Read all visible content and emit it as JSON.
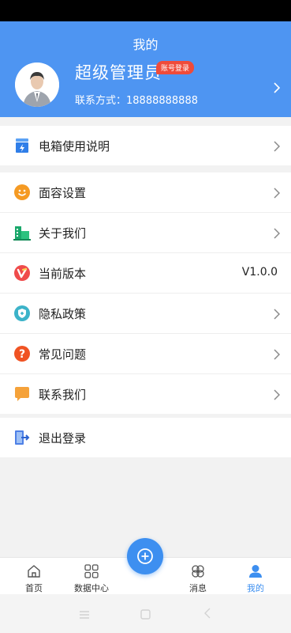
{
  "header": {
    "title": "我的",
    "username": "超级管理员",
    "badge": "账号登录",
    "contact": "联系方式：18888888888"
  },
  "menu_top": [
    {
      "label": "电箱使用说明",
      "icon": "electric-box-icon"
    }
  ],
  "menu_main": [
    {
      "label": "面容设置",
      "icon": "face-icon"
    },
    {
      "label": "关于我们",
      "icon": "building-icon"
    },
    {
      "label": "当前版本",
      "icon": "version-icon",
      "value": "V1.0.0"
    },
    {
      "label": "隐私政策",
      "icon": "shield-icon"
    },
    {
      "label": "常见问题",
      "icon": "question-icon"
    },
    {
      "label": "联系我们",
      "icon": "chat-icon"
    }
  ],
  "menu_bottom": [
    {
      "label": "退出登录",
      "icon": "logout-icon"
    }
  ],
  "tabbar": {
    "items": [
      {
        "label": "首页",
        "icon": "home-icon"
      },
      {
        "label": "数据中心",
        "icon": "grid-icon"
      },
      {
        "label": "消息",
        "icon": "message-icon"
      },
      {
        "label": "我的",
        "icon": "user-icon",
        "active": true
      }
    ]
  },
  "colors": {
    "primary": "#4e95f2",
    "active_tab": "#3d8ff0"
  }
}
